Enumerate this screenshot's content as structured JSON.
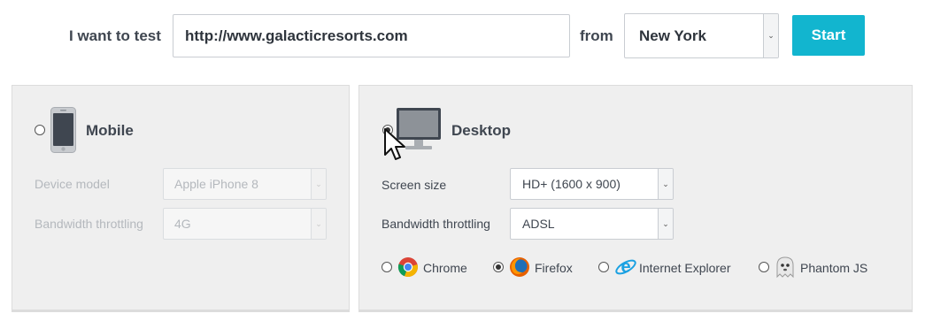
{
  "top_bar": {
    "prefix_label": "I want to test",
    "url_value": "http://www.galacticresorts.com",
    "from_label": "from",
    "location_value": "New York",
    "start_label": "Start"
  },
  "mobile": {
    "title": "Mobile",
    "device_model_label": "Device model",
    "device_model_value": "Apple iPhone 8",
    "bandwidth_label": "Bandwidth throttling",
    "bandwidth_value": "4G",
    "selected": false
  },
  "desktop": {
    "title": "Desktop",
    "screen_size_label": "Screen size",
    "screen_size_value": "HD+ (1600 x 900)",
    "bandwidth_label": "Bandwidth throttling",
    "bandwidth_value": "ADSL",
    "selected": true
  },
  "browsers": [
    {
      "label": "Chrome",
      "icon": "chrome-icon",
      "selected": false
    },
    {
      "label": "Firefox",
      "icon": "firefox-icon",
      "selected": true
    },
    {
      "label": "Internet Explorer",
      "icon": "internet-explorer-icon",
      "selected": false
    },
    {
      "label": "Phantom JS",
      "icon": "phantomjs-icon",
      "selected": false
    }
  ],
  "colors": {
    "accent": "#12b5cf",
    "panel_bg": "#efefef",
    "text": "#3f4650",
    "disabled_text": "#b4b8bd"
  }
}
